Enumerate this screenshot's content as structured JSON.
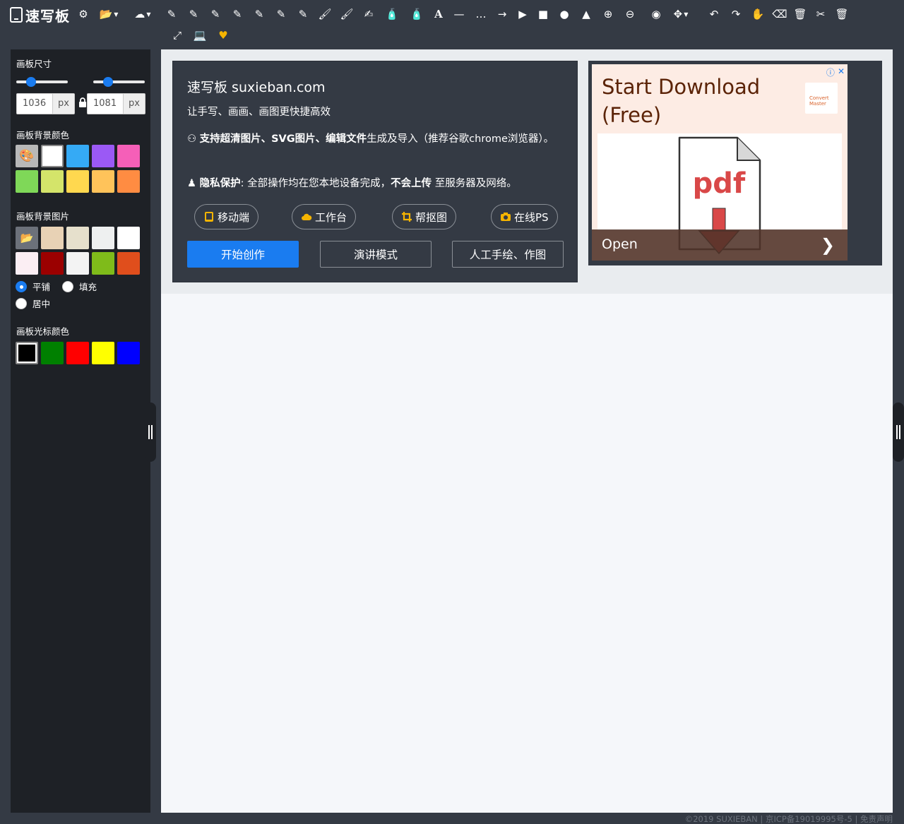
{
  "app": {
    "name": "速写板"
  },
  "toolbar": {
    "tools": [
      {
        "icon": "gear-icon"
      },
      {
        "icon": "folder-open-icon"
      },
      {
        "icon": "cloud-download-icon"
      },
      {
        "icon": "pencil-icon"
      },
      {
        "icon": "pencil-icon"
      },
      {
        "icon": "pencil-icon"
      },
      {
        "icon": "pencil-icon"
      },
      {
        "icon": "pencil-icon"
      },
      {
        "icon": "pencil-icon"
      },
      {
        "icon": "pencil-icon"
      },
      {
        "icon": "paintbrush-icon"
      },
      {
        "icon": "paintbrush-icon"
      },
      {
        "icon": "marker-icon"
      },
      {
        "icon": "spray-icon"
      },
      {
        "icon": "spray-icon"
      },
      {
        "icon": "text-icon"
      },
      {
        "icon": "line-icon"
      },
      {
        "icon": "dotted-line-icon"
      },
      {
        "icon": "arrow-right-icon"
      },
      {
        "icon": "play-icon"
      },
      {
        "icon": "square-icon"
      },
      {
        "icon": "circle-icon"
      },
      {
        "icon": "shapes-icon"
      },
      {
        "icon": "zoom-in-icon"
      },
      {
        "icon": "zoom-out-icon"
      },
      {
        "icon": "target-icon"
      },
      {
        "icon": "move-icon"
      },
      {
        "icon": "undo-icon"
      },
      {
        "icon": "redo-icon"
      },
      {
        "icon": "hand-icon"
      },
      {
        "icon": "eraser-icon"
      },
      {
        "icon": "trash-icon"
      },
      {
        "icon": "scissors-icon"
      },
      {
        "icon": "trash-icon"
      },
      {
        "icon": "fullscreen-icon"
      },
      {
        "icon": "laptop-icon"
      },
      {
        "icon": "heart-icon"
      }
    ],
    "heart_color": "#f5b400"
  },
  "sidebar": {
    "size_title": "画板尺寸",
    "width_value": "1036",
    "height_value": "1081",
    "unit": "px",
    "bg_color_title": "画板背景颜色",
    "bg_colors": [
      "#b8b8b8",
      "#ffffff",
      "#35aaf5",
      "#9b59f5",
      "#f55fb8",
      "#7fd858",
      "#d4e46a",
      "#ffd84f",
      "#ffc35a",
      "#ff8c42"
    ],
    "bg_image_title": "画板背景图片",
    "bg_image_swatches": [
      "#6c717a",
      "#e8d2b5",
      "#e6e0cc",
      "#eef0f0",
      "#ffffff",
      "#fbeef3",
      "#9b0000",
      "#f3f3f3",
      "#7fbb1a",
      "#e04e1c"
    ],
    "radio_tile": "平铺",
    "radio_fill": "填充",
    "radio_center": "居中",
    "cursor_color_title": "画板光标颜色",
    "cursor_colors": [
      "#000000",
      "#008000",
      "#ff0000",
      "#ffff00",
      "#0000ff"
    ]
  },
  "intro": {
    "title": "速写板 suxieban.com",
    "subtitle": "让手写、画画、画图更快捷高效",
    "feature1_bold": "支持超清图片、SVG图片、编辑文件",
    "feature1_rest": "生成及导入（推荐谷歌chrome浏览器）。",
    "feature2_bold": "隐私保护",
    "feature2_mid": ": 全部操作均在您本地设备完成，",
    "feature2_bold2": "不会上传",
    "feature2_rest": " 至服务器及网络。",
    "pills": [
      "移动端",
      "工作台",
      "帮抠图",
      "在线PS"
    ],
    "btn_start": "开始创作",
    "btn_present": "演讲模式",
    "btn_draw": "人工手绘、作图",
    "accent": "#1a7cf0",
    "icon_color": "#f5b400"
  },
  "ad": {
    "title": "Start Download (Free)",
    "file_label": "pdf",
    "open_label": "Open",
    "logo_text": "Convert Master"
  },
  "footer": {
    "text": "©2019 SUXIEBAN | 京ICP备19019995号-5 | 免责声明"
  }
}
